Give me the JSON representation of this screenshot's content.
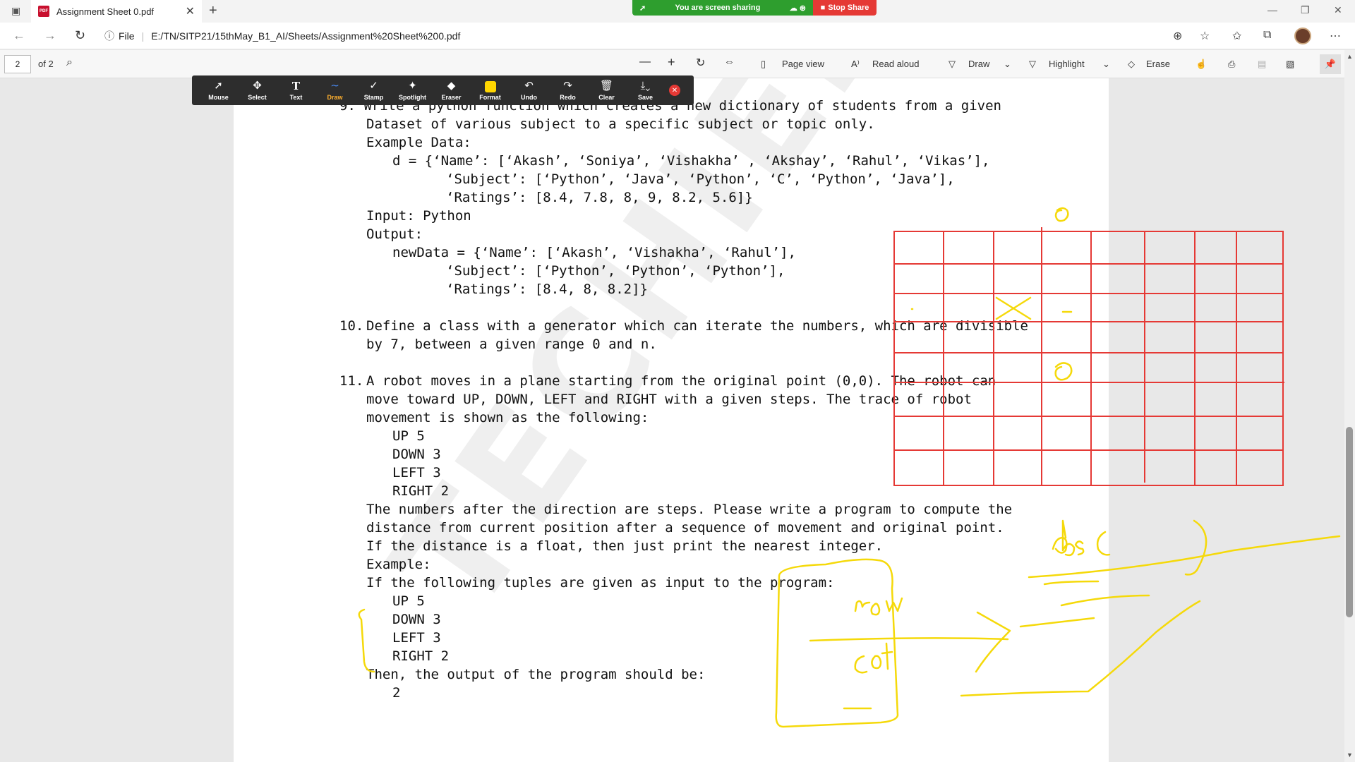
{
  "browser": {
    "tab_title": "Assignment Sheet 0.pdf",
    "url_label": "File",
    "url": "E:/TN/SITP21/15thMay_B1_AI/Sheets/Assignment%20Sheet%200.pdf"
  },
  "share_banner": {
    "status": "You are screen sharing",
    "stop_label": "Stop Share"
  },
  "pdf_toolbar": {
    "page_number": "2",
    "page_total": "of 2",
    "page_view": "Page view",
    "read_aloud": "Read aloud",
    "draw": "Draw",
    "highlight": "Highlight",
    "erase": "Erase"
  },
  "annotation_toolbar": {
    "tools": [
      "Mouse",
      "Select",
      "Text",
      "Draw",
      "Stamp",
      "Spotlight",
      "Eraser",
      "Format",
      "Undo",
      "Redo",
      "Clear",
      "Save"
    ],
    "active_tool": "Draw",
    "format_color": "#ffd600"
  },
  "document": {
    "watermark": "TECHIEN",
    "lines": [
      "9. Write a python function which creates a new dictionary of students from a given",
      "Dataset of various subject to a specific subject or topic only.",
      "Example Data:",
      "d = {‘Name’: [‘Akash’, ‘Soniya’, ‘Vishakha’ , ‘Akshay’, ‘Rahul’, ‘Vikas’],",
      "‘Subject’: [‘Python’, ‘Java’, ‘Python’, ‘C’, ‘Python’, ‘Java’],",
      "‘Ratings’: [8.4, 7.8, 8, 9, 8.2, 5.6]}",
      "Input: Python",
      "Output:",
      "newData = {‘Name’: [‘Akash’, ‘Vishakha’, ‘Rahul’],",
      "‘Subject’: [‘Python’, ‘Python’, ‘Python’],",
      "‘Ratings’: [8.4, 8, 8.2]}",
      "10.",
      "Define a class with a generator which can iterate the numbers, which are divisible",
      "by 7, between a given range 0 and n.",
      "11.",
      "A robot moves in a plane starting from the original point (0,0). The robot can",
      "move toward UP, DOWN, LEFT and RIGHT with a given steps. The trace of robot",
      "movement is shown as the following:",
      "UP 5",
      "DOWN 3",
      "LEFT 3",
      "RIGHT 2",
      "The numbers after the direction are steps. Please write a program to compute the",
      "distance from current position after a sequence of movement and original point.",
      "If the distance is a float, then just print the nearest integer.",
      "Example:",
      "If the following tuples are given as input to the program:",
      "UP 5",
      "DOWN 3",
      "LEFT 3",
      "RIGHT 2",
      "Then, the output of the program should be:",
      "2"
    ]
  },
  "ink": {
    "colors": {
      "grid": "#e53935",
      "pen": "#f5d90a",
      "pen_dark": "#e8c800"
    },
    "handwriting": [
      "abs(  )",
      "row",
      "col"
    ]
  }
}
